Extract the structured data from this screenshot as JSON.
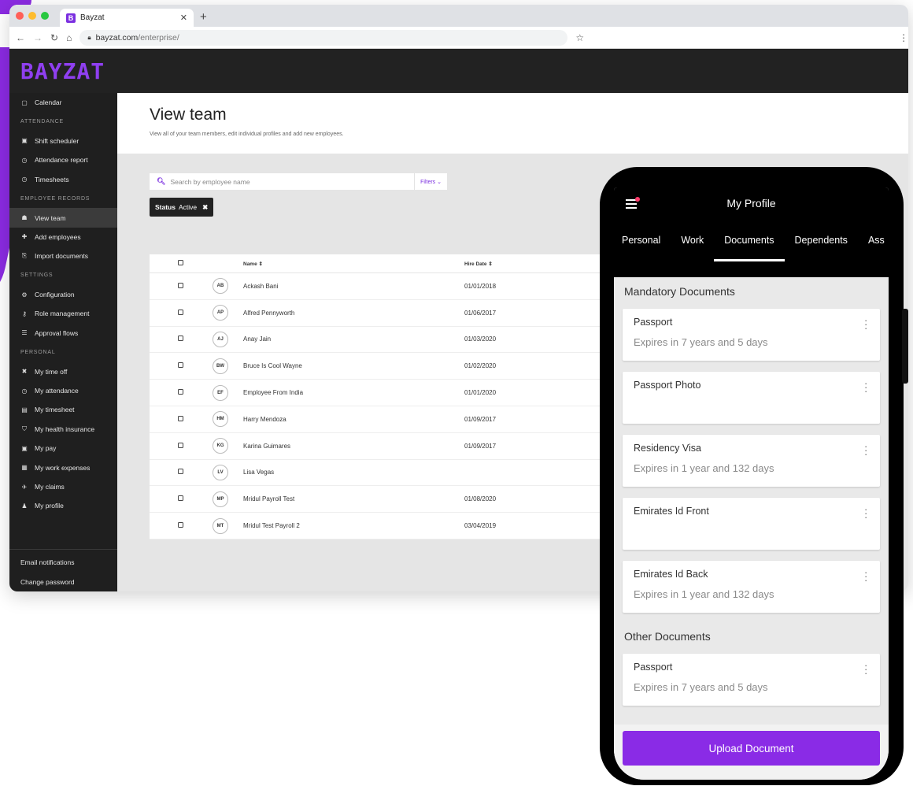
{
  "browser": {
    "tab_title": "Bayzat",
    "tab_favicon": "B",
    "url_host": "bayzat.com",
    "url_path": "/enterprise/"
  },
  "brand": {
    "logo_text": "BAYZAT",
    "accent": "#8b2be2"
  },
  "sidebar": {
    "items": [
      {
        "type": "item",
        "label": "Calendar",
        "icon": "calendar-icon",
        "glyph": "▢"
      },
      {
        "type": "section",
        "label": "ATTENDANCE"
      },
      {
        "type": "item",
        "label": "Shift scheduler",
        "icon": "shift-icon",
        "glyph": "▣"
      },
      {
        "type": "item",
        "label": "Attendance report",
        "icon": "clock-icon",
        "glyph": "◷"
      },
      {
        "type": "item",
        "label": "Timesheets",
        "icon": "clock-icon",
        "glyph": "◷"
      },
      {
        "type": "section",
        "label": "EMPLOYEE RECORDS"
      },
      {
        "type": "item",
        "label": "View team",
        "icon": "team-icon",
        "glyph": "☗",
        "active": true
      },
      {
        "type": "item",
        "label": "Add employees",
        "icon": "add-user-icon",
        "glyph": "✚"
      },
      {
        "type": "item",
        "label": "Import documents",
        "icon": "import-icon",
        "glyph": "⎘"
      },
      {
        "type": "section",
        "label": "SETTINGS"
      },
      {
        "type": "item",
        "label": "Configuration",
        "icon": "gear-icon",
        "glyph": "⚙"
      },
      {
        "type": "item",
        "label": "Role management",
        "icon": "key-icon",
        "glyph": "⚷"
      },
      {
        "type": "item",
        "label": "Approval flows",
        "icon": "list-icon",
        "glyph": "☰"
      },
      {
        "type": "section",
        "label": "PERSONAL"
      },
      {
        "type": "item",
        "label": "My time off",
        "icon": "plane-icon",
        "glyph": "✖"
      },
      {
        "type": "item",
        "label": "My attendance",
        "icon": "clock-icon",
        "glyph": "◷"
      },
      {
        "type": "item",
        "label": "My timesheet",
        "icon": "timesheet-icon",
        "glyph": "▤"
      },
      {
        "type": "item",
        "label": "My health insurance",
        "icon": "shield-icon",
        "glyph": "⛉"
      },
      {
        "type": "item",
        "label": "My pay",
        "icon": "pay-icon",
        "glyph": "▣"
      },
      {
        "type": "item",
        "label": "My work expenses",
        "icon": "receipt-icon",
        "glyph": "▦"
      },
      {
        "type": "item",
        "label": "My claims",
        "icon": "claims-icon",
        "glyph": "✈"
      },
      {
        "type": "item",
        "label": "My profile",
        "icon": "person-icon",
        "glyph": "♟"
      }
    ],
    "footer": [
      {
        "label": "Email notifications"
      },
      {
        "label": "Change password"
      }
    ]
  },
  "page": {
    "title": "View team",
    "subtitle": "View all of your team members, edit individual profiles and add new employees.",
    "search_placeholder": "Search by employee name",
    "filters_label": "Filters ⌄",
    "chip_key": "Status",
    "chip_value": "Active"
  },
  "table": {
    "columns": [
      "Name ⇕",
      "Hire Date ⇕"
    ],
    "rows": [
      {
        "initials": "AB",
        "name": "Ackash Bani",
        "hire_date": "01/01/2018"
      },
      {
        "initials": "AP",
        "name": "Alfred Pennyworth",
        "hire_date": "01/06/2017"
      },
      {
        "initials": "AJ",
        "name": "Anay Jain",
        "hire_date": "01/03/2020"
      },
      {
        "initials": "BW",
        "name": "Bruce Is Cool Wayne",
        "hire_date": "01/02/2020"
      },
      {
        "initials": "EF",
        "name": "Employee From India",
        "hire_date": "01/01/2020"
      },
      {
        "initials": "HM",
        "name": "Harry Mendoza",
        "hire_date": "01/09/2017"
      },
      {
        "initials": "KG",
        "name": "Karina Guimares",
        "hire_date": "01/09/2017"
      },
      {
        "initials": "LV",
        "name": "Lisa Vegas",
        "hire_date": ""
      },
      {
        "initials": "MP",
        "name": "Mridul Payroll Test",
        "hire_date": "01/08/2020"
      },
      {
        "initials": "MT",
        "name": "Mridul Test Payroll 2",
        "hire_date": "03/04/2019"
      }
    ]
  },
  "phone": {
    "title": "My Profile",
    "tabs": [
      {
        "label": "Personal"
      },
      {
        "label": "Work"
      },
      {
        "label": "Documents",
        "active": true
      },
      {
        "label": "Dependents"
      },
      {
        "label": "Ass"
      }
    ],
    "mandatory_title": "Mandatory Documents",
    "mandatory_docs": [
      {
        "name": "Passport",
        "status": "Expires in 7 years and 5 days"
      },
      {
        "name": "Passport Photo",
        "status": ""
      },
      {
        "name": "Residency Visa",
        "status": "Expires in 1 year and 132 days"
      },
      {
        "name": "Emirates Id Front",
        "status": ""
      },
      {
        "name": "Emirates Id Back",
        "status": "Expires in 1 year and 132 days"
      }
    ],
    "other_title": "Other Documents",
    "other_docs": [
      {
        "name": "Passport",
        "status": "Expires in 7 years and 5 days"
      }
    ],
    "upload_label": "Upload Document"
  }
}
